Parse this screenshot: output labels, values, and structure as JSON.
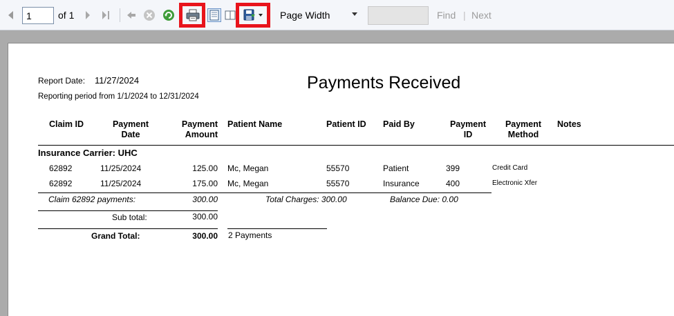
{
  "toolbar": {
    "page_input": "1",
    "of_label": "of",
    "total_pages": "1",
    "zoom_value": "Page Width",
    "find_placeholder": "",
    "find_label": "Find",
    "find_separator": "|",
    "next_label": "Next",
    "highlight_color": "#e8141c"
  },
  "report": {
    "report_date_label": "Report Date:",
    "report_date": "11/27/2024",
    "reporting_period": "Reporting period from 1/1/2024 to 12/31/2024",
    "title": "Payments Received",
    "columns": {
      "claim_id": "Claim ID",
      "payment_date_1": "Payment",
      "payment_date_2": "Date",
      "payment_amount_1": "Payment",
      "payment_amount_2": "Amount",
      "patient_name": "Patient Name",
      "patient_id": "Patient ID",
      "paid_by": "Paid By",
      "payment_id_1": "Payment",
      "payment_id_2": "ID",
      "payment_method_1": "Payment",
      "payment_method_2": "Method",
      "notes": "Notes"
    },
    "group_header": "Insurance Carrier: UHC",
    "rows": [
      {
        "claim_id": "62892",
        "payment_date": "11/25/2024",
        "amount": "125.00",
        "patient_name": "Mc, Megan",
        "patient_id": "55570",
        "paid_by": "Patient",
        "payment_id": "399",
        "method": "Credit Card"
      },
      {
        "claim_id": "62892",
        "payment_date": "11/25/2024",
        "amount": "175.00",
        "patient_name": "Mc, Megan",
        "patient_id": "55570",
        "paid_by": "Insurance",
        "payment_id": "400",
        "method": "Electronic Xfer"
      }
    ],
    "claim_summary": {
      "label": "Claim 62892 payments:",
      "amount": "300.00",
      "total_charges": "Total Charges: 300.00",
      "balance_due": "Balance Due: 0.00"
    },
    "subtotal": {
      "label": "Sub total:",
      "amount": "300.00"
    },
    "grand_total": {
      "label": "Grand Total:",
      "amount": "300.00",
      "count": "2 Payments"
    }
  }
}
